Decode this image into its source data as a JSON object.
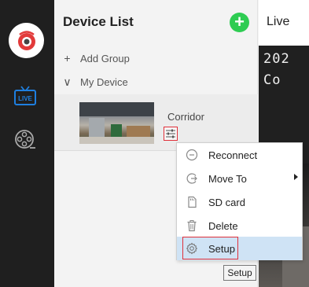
{
  "sidebar": {
    "logo_icon": "camera-eye-logo",
    "live_icon": "tv-live-icon",
    "live_label": "LIVE",
    "playback_icon": "film-reel-icon"
  },
  "device_list": {
    "title": "Device List",
    "add_button_symbol": "+",
    "add_group": {
      "symbol": "+",
      "label": "Add Group"
    },
    "my_device": {
      "symbol": "∨",
      "label": "My Device"
    },
    "devices": [
      {
        "name": "Corridor",
        "settings_icon": "settings-sliders-icon"
      }
    ]
  },
  "live": {
    "title": "Live",
    "osd_line1": "202",
    "osd_line2": "Co"
  },
  "context_menu": {
    "items": [
      {
        "label": "Reconnect",
        "icon": "reconnect-icon"
      },
      {
        "label": "Move To",
        "icon": "move-to-icon",
        "has_submenu": true
      },
      {
        "label": "SD card",
        "icon": "sd-card-icon"
      },
      {
        "label": "Delete",
        "icon": "trash-icon"
      },
      {
        "label": "Setup",
        "icon": "gear-icon",
        "highlighted": true
      }
    ]
  },
  "tooltip": {
    "text": "Setup"
  },
  "colors": {
    "rail_bg": "#1f1f1f",
    "accent_green": "#2ecc52",
    "accent_blue": "#1e7fe0",
    "highlight_red": "#e0303a",
    "selection_blue": "#cfe3f5"
  }
}
